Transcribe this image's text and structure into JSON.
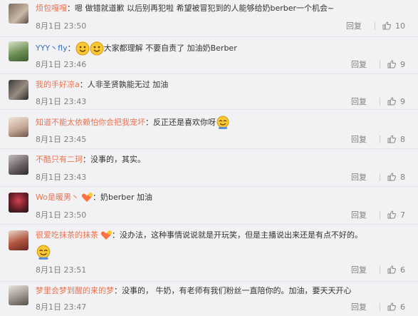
{
  "comments": [
    {
      "user": "烦包嘎嘎",
      "text": "嗯 做错就道歉 以后别再犯啦 希望被冒犯到的人能够给奶berber一个机会~",
      "time": "8月1日 23:50",
      "reply": "回复",
      "likes": "10"
    },
    {
      "user": "YYY丶fly",
      "text": "大家都理解 不要自责了 加油奶Berber",
      "time": "8月1日 23:46",
      "reply": "回复",
      "likes": "9"
    },
    {
      "user": "我的手好凉a",
      "text": "人非圣贤孰能无过 加油",
      "time": "8月1日 23:43",
      "reply": "回复",
      "likes": "9"
    },
    {
      "user": "知道不能太依赖怕你会把我宠坏",
      "text": "反正还是喜欢你呀",
      "time": "8月1日 23:45",
      "reply": "回复",
      "likes": "8"
    },
    {
      "user": "不酷只有二珂",
      "text": "没事的，其实。",
      "time": "8月1日 23:43",
      "reply": "回复",
      "likes": "8"
    },
    {
      "user": "Wo是暖男丶",
      "text": "奶berber 加油",
      "time": "8月1日 23:50",
      "reply": "回复",
      "likes": "7"
    },
    {
      "user": "很爱吃抹茶的抹茶",
      "text": "没办法，这种事情说说就是开玩笑，但是主播说出来还是有点不好的。",
      "time": "8月1日 23:51",
      "reply": "回复",
      "likes": "6"
    },
    {
      "user": "梦里会梦到醒的来的梦",
      "text": "没事的， 牛奶，有老师有我们粉丝一直陪你的。加油，要天天开心",
      "time": "8月1日 23:47",
      "reply": "回复",
      "likes": "6"
    }
  ],
  "colors": {
    "username": "#eb7350",
    "username_alt": "#3b6fc4",
    "meta": "#808080",
    "background": "#f2f2f5"
  }
}
